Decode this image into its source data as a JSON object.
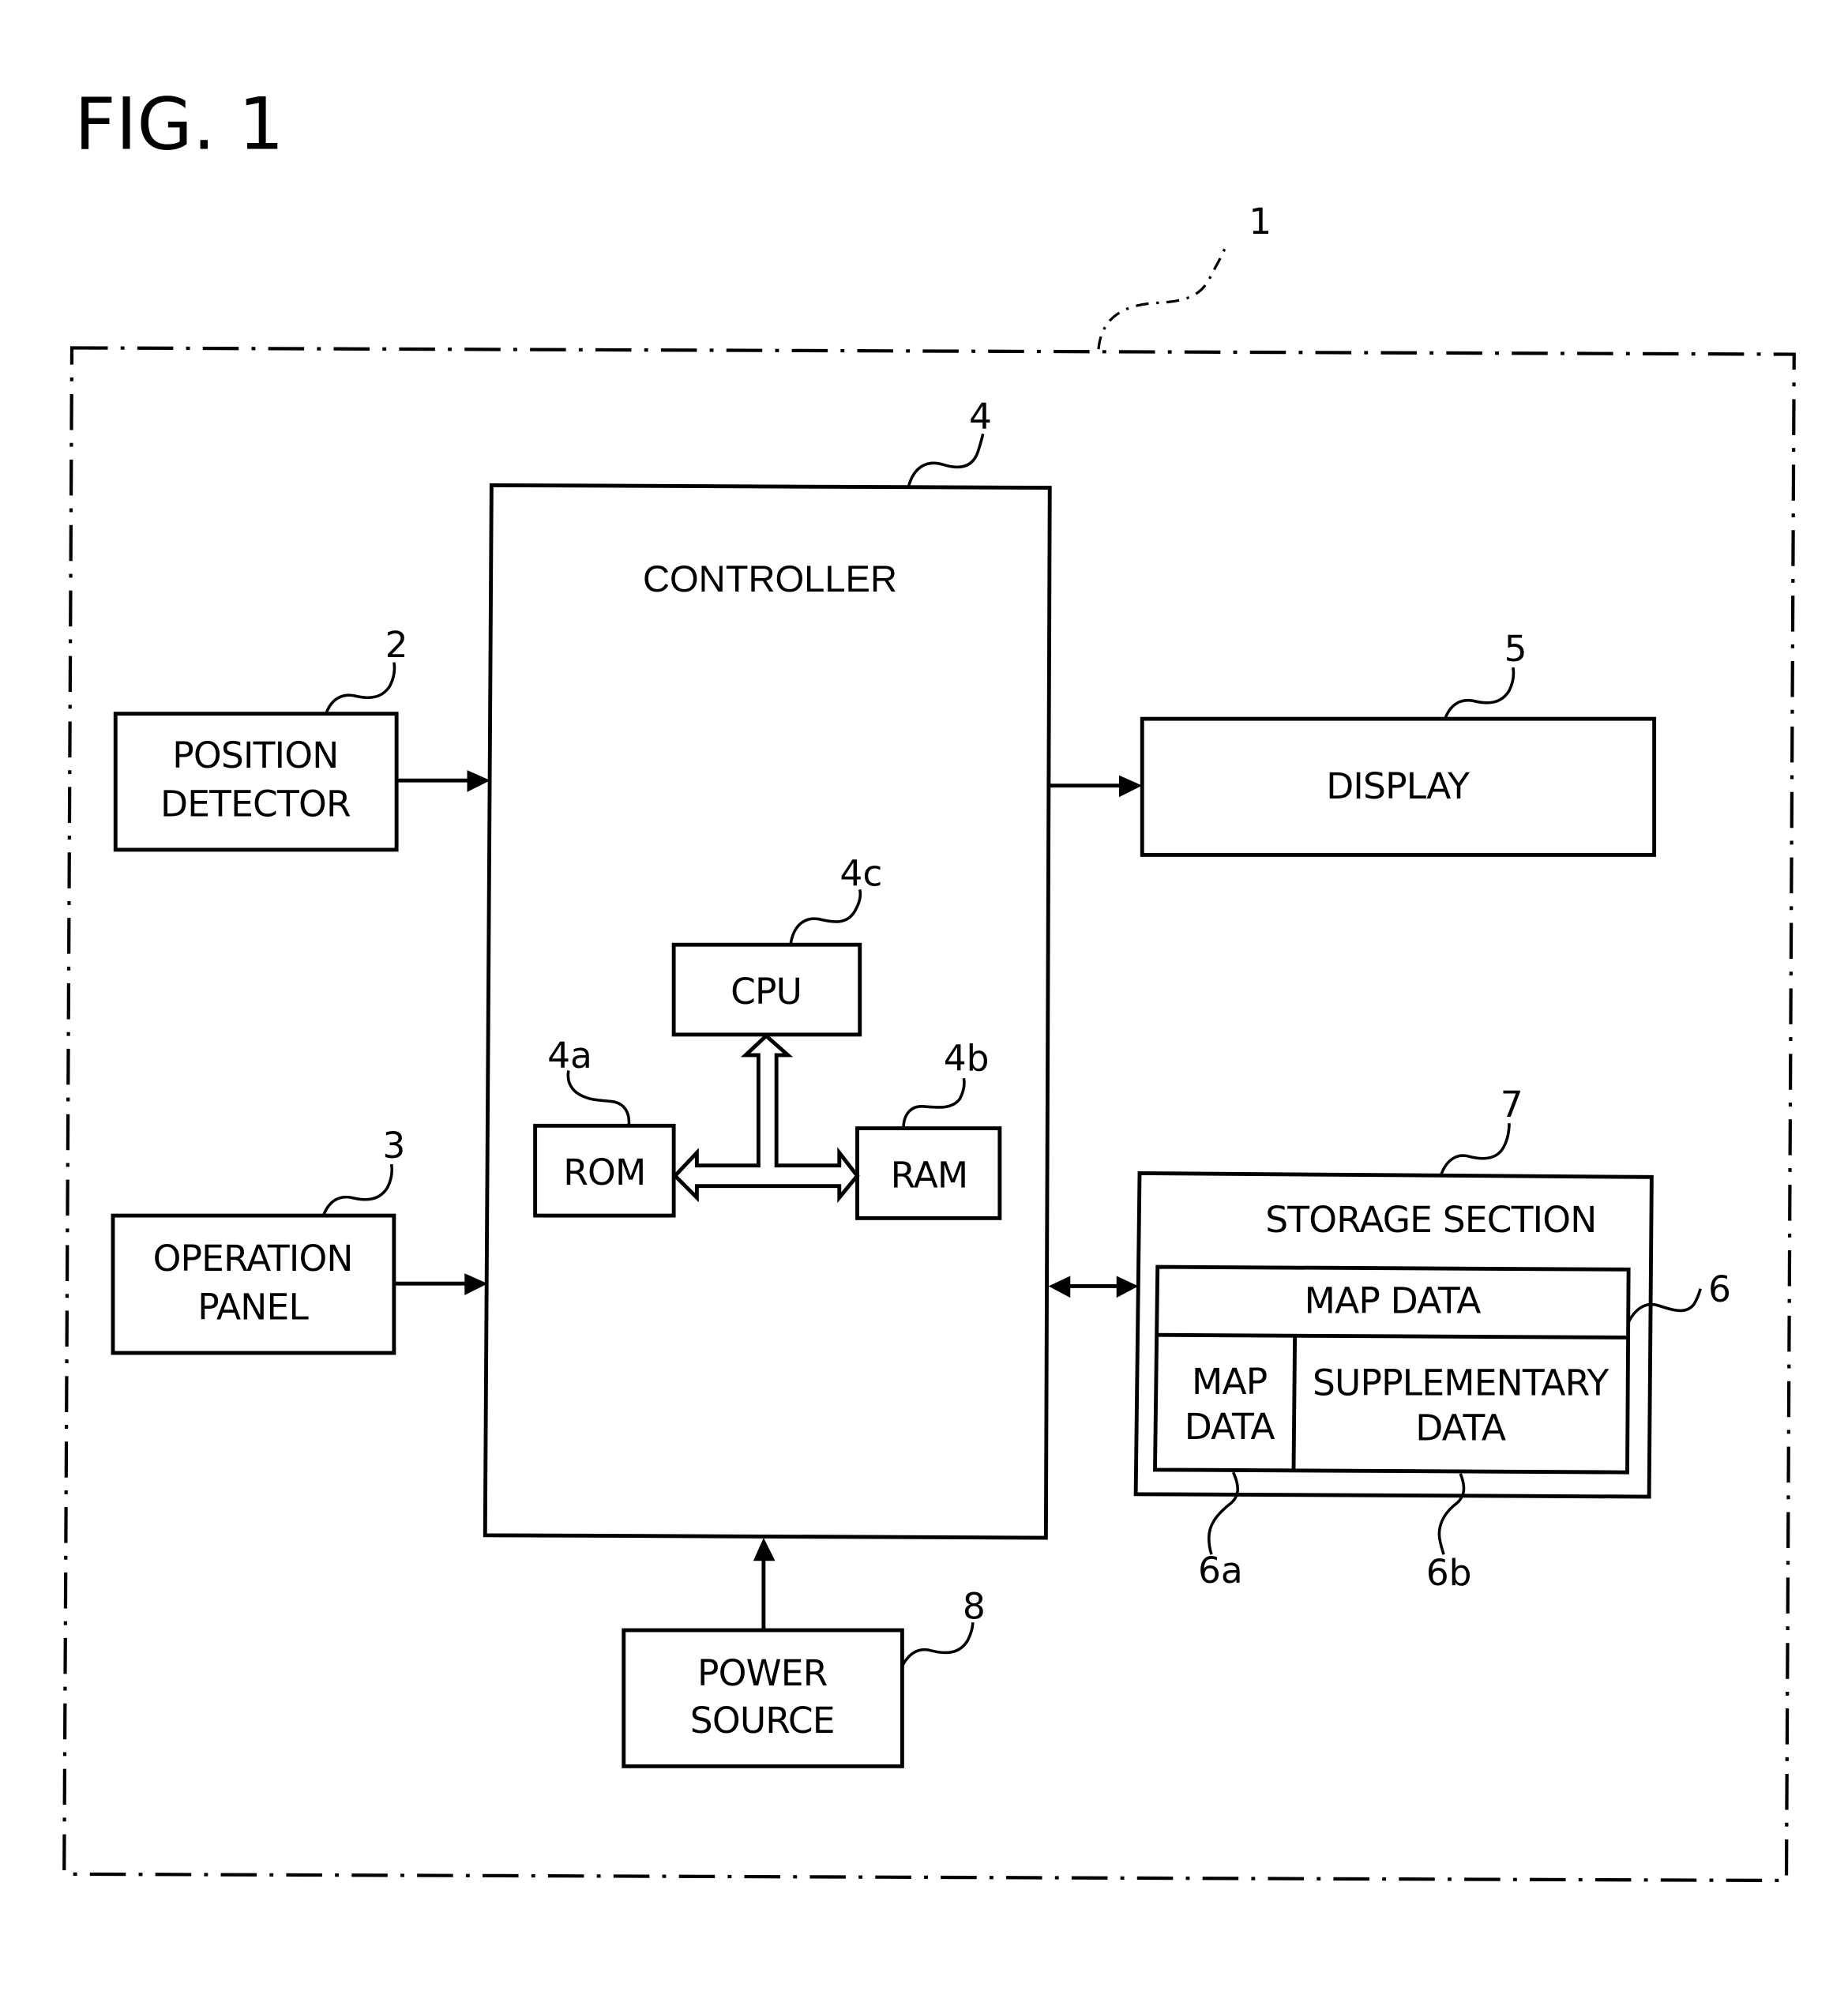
{
  "figure": {
    "title": "FIG. 1"
  },
  "device": {
    "ref": "1"
  },
  "controller": {
    "ref": "4",
    "label": "CONTROLLER",
    "cpu": {
      "ref": "4c",
      "label": "CPU"
    },
    "rom": {
      "ref": "4a",
      "label": "ROM"
    },
    "ram": {
      "ref": "4b",
      "label": "RAM"
    }
  },
  "position_detector": {
    "ref": "2",
    "label_lines": [
      "POSITION",
      "DETECTOR"
    ]
  },
  "operation_panel": {
    "ref": "3",
    "label_lines": [
      "OPERATION",
      "PANEL"
    ]
  },
  "display": {
    "ref": "5",
    "label": "DISPLAY"
  },
  "storage_section": {
    "ref": "7",
    "label": "STORAGE SECTION",
    "map_data_block": {
      "ref": "6",
      "label": "MAP DATA",
      "sub_map_data": {
        "ref": "6a",
        "label_lines": [
          "MAP",
          "DATA"
        ]
      },
      "supplementary_data": {
        "ref": "6b",
        "label_lines": [
          "SUPPLEMENTARY",
          "DATA"
        ]
      }
    }
  },
  "power_source": {
    "ref": "8",
    "label_lines": [
      "POWER",
      "SOURCE"
    ]
  },
  "connections": [
    {
      "from": "POSITION DETECTOR",
      "to": "CONTROLLER",
      "direction": "one-way"
    },
    {
      "from": "OPERATION PANEL",
      "to": "CONTROLLER",
      "direction": "one-way"
    },
    {
      "from": "CONTROLLER",
      "to": "DISPLAY",
      "direction": "one-way"
    },
    {
      "from": "CONTROLLER",
      "to": "STORAGE SECTION",
      "direction": "two-way"
    },
    {
      "from": "POWER SOURCE",
      "to": "CONTROLLER",
      "direction": "one-way"
    },
    {
      "from": "CPU",
      "to": "ROM/RAM",
      "direction": "bus"
    }
  ]
}
